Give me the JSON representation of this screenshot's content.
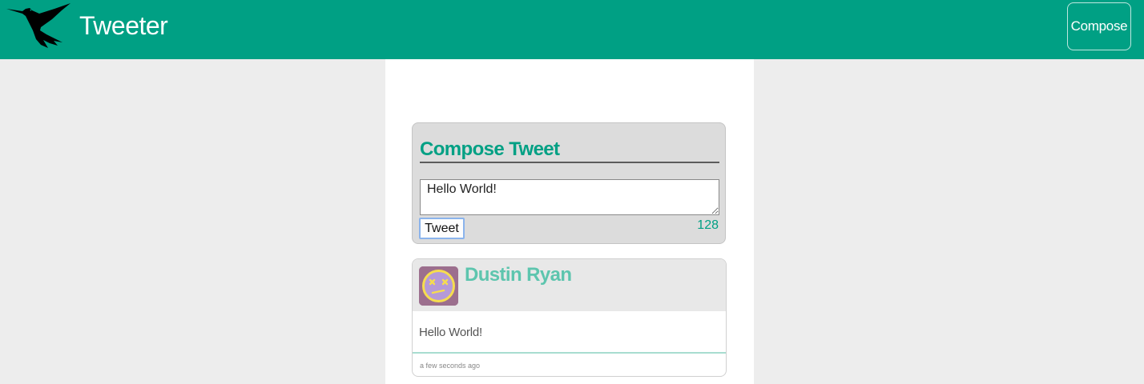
{
  "nav": {
    "brand": "Tweeter",
    "compose_label": "Compose",
    "logo_icon": "hummingbird-icon"
  },
  "compose": {
    "title": "Compose Tweet",
    "textarea_value": "Hello World!",
    "submit_label": "Tweet",
    "char_count": "128"
  },
  "tweets": [
    {
      "author": "Dustin Ryan",
      "avatar_icon": "dizzy-face-avatar-icon",
      "text": "Hello World!",
      "time": "a few seconds ago"
    }
  ],
  "colors": {
    "accent": "#00a084",
    "author": "#5dc5ae",
    "background": "#ededed",
    "card": "#dcdcdc"
  }
}
